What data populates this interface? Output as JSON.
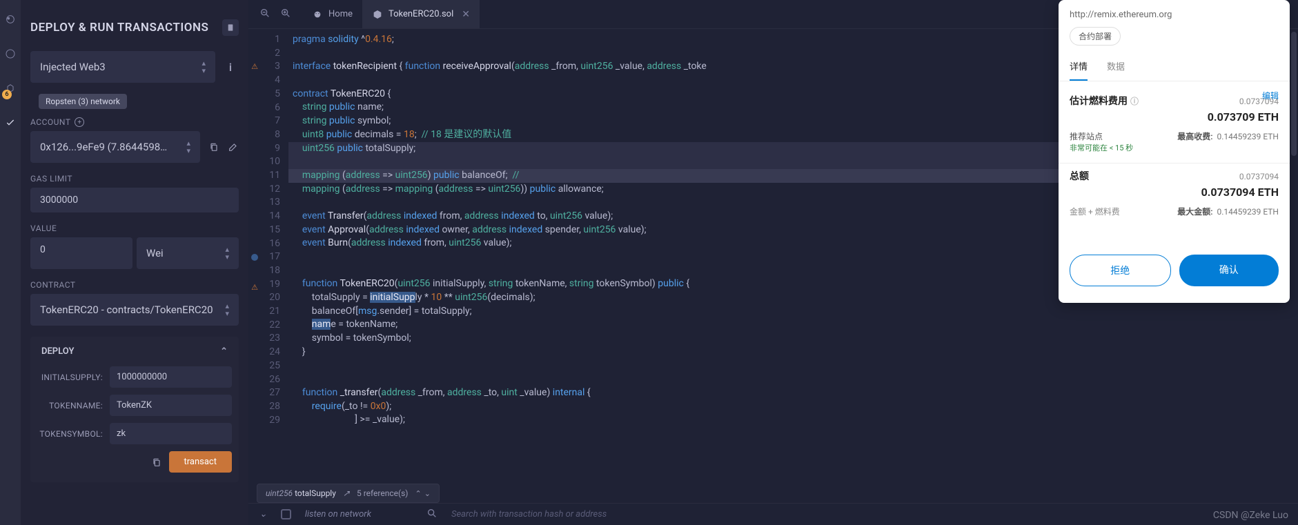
{
  "panel": {
    "title": "DEPLOY & RUN TRANSACTIONS",
    "environment": "Injected Web3",
    "network_tooltip": "Ropsten (3) network",
    "account_label": "ACCOUNT",
    "account": "0x126...9eFe9 (7.8644598…",
    "gas_label": "GAS LIMIT",
    "gas_limit": "3000000",
    "value_label": "VALUE",
    "value_amount": "0",
    "value_unit": "Wei",
    "contract_label": "CONTRACT",
    "contract": "TokenERC20 - contracts/TokenERC20",
    "deploy_label": "DEPLOY",
    "params": [
      {
        "label": "INITIALSUPPLY:",
        "value": "1000000000"
      },
      {
        "label": "TOKENNAME:",
        "value": "TokenZK"
      },
      {
        "label": "TOKENSYMBOL:",
        "value": "zk"
      }
    ],
    "transact": "transact"
  },
  "tabs": {
    "home": "Home",
    "file": "TokenERC20.sol"
  },
  "code": {
    "lines": [
      {
        "n": 1,
        "h": "<span class='kw'>pragma</span> <span class='kw2'>solidity</span> <span class='op'>^</span><span class='num'>0.4.16</span>;"
      },
      {
        "n": 2,
        "h": ""
      },
      {
        "n": 3,
        "warn": true,
        "h": "<span class='kw'>interface</span> <span class='id'>tokenRecipient</span> { <span class='kw'>function</span> <span class='id'>receiveApproval</span>(<span class='ty'>address</span> _from, <span class='ty'>uint256</span> _value, <span class='ty'>address</span> _toke"
      },
      {
        "n": 4,
        "h": ""
      },
      {
        "n": 5,
        "h": "<span class='kw'>contract</span> <span class='id'>TokenERC20</span> {"
      },
      {
        "n": 6,
        "h": "    <span class='ty'>string</span> <span class='kw2'>public</span> name;"
      },
      {
        "n": 7,
        "h": "    <span class='ty'>string</span> <span class='kw2'>public</span> symbol;"
      },
      {
        "n": 8,
        "h": "    <span class='ty'>uint8</span> <span class='kw2'>public</span> decimals = <span class='num'>18</span>;  <span class='cm'>// 18 是建议的默认值</span>"
      },
      {
        "n": 9,
        "cur": true,
        "h": "    <span class='ty'>uint256</span> <span class='kw2'>public</span> totalSupply;"
      },
      {
        "n": 10,
        "cur": true,
        "h": ""
      },
      {
        "n": 11,
        "hl": true,
        "h": "    <span class='ty'>mapping</span> (<span class='ty'>address</span> =&gt; <span class='ty'>uint256</span>) <span class='kw2'>public</span> balanceOf;  <span class='cm'>//</span>"
      },
      {
        "n": 12,
        "h": "    <span class='ty'>mapping</span> (<span class='ty'>address</span> =&gt; <span class='ty'>mapping</span> (<span class='ty'>address</span> =&gt; <span class='ty'>uint256</span>)) <span class='kw2'>public</span> allowance;"
      },
      {
        "n": 13,
        "h": ""
      },
      {
        "n": 14,
        "h": "    <span class='kw'>event</span> <span class='id'>Transfer</span>(<span class='ty'>address</span> <span class='kw2'>indexed</span> from, <span class='ty'>address</span> <span class='kw2'>indexed</span> to, <span class='ty'>uint256</span> value);"
      },
      {
        "n": 15,
        "h": "    <span class='kw'>event</span> <span class='id'>Approval</span>(<span class='ty'>address</span> <span class='kw2'>indexed</span> owner, <span class='ty'>address</span> <span class='kw2'>indexed</span> spender, <span class='ty'>uint256</span> value);"
      },
      {
        "n": 16,
        "h": "    <span class='kw'>event</span> <span class='id'>Burn</span>(<span class='ty'>address</span> <span class='kw2'>indexed</span> from, <span class='ty'>uint256</span> value);"
      },
      {
        "n": 17,
        "bp": true,
        "h": ""
      },
      {
        "n": 18,
        "h": ""
      },
      {
        "n": 19,
        "warn": true,
        "h": "    <span class='kw'>function</span> <span class='id'>TokenERC20</span>(<span class='ty'>uint256</span> initialSupply, <span class='ty'>string</span> tokenName, <span class='ty'>string</span> tokenSymbol) <span class='kw2'>public</span> {"
      },
      {
        "n": 20,
        "h": "        totalSupply = <span class='sel'>initialSupp</span>ly * <span class='num'>10</span> ** <span class='ty'>uint256</span>(decimals);"
      },
      {
        "n": 21,
        "h": "        balanceOf[<span class='kw2'>msg</span>.sender] = totalSupply;"
      },
      {
        "n": 22,
        "h": "        <span class='sel'>nam</span>e = tokenName;"
      },
      {
        "n": 23,
        "h": "        symbol = tokenSymbol;"
      },
      {
        "n": 24,
        "h": "    }"
      },
      {
        "n": 25,
        "h": ""
      },
      {
        "n": 26,
        "h": ""
      },
      {
        "n": 27,
        "h": "    <span class='kw'>function</span> <span class='id'>_transfer</span>(<span class='ty'>address</span> _from, <span class='ty'>address</span> _to, <span class='ty'>uint</span> _value) <span class='kw2'>internal</span> {"
      },
      {
        "n": 28,
        "h": "        <span class='kw2'>require</span>(_to != <span class='num'>0x0</span>);"
      },
      {
        "n": 29,
        "h": "                          ] &gt;= _value);"
      }
    ]
  },
  "ref_bar": {
    "type": "uint256",
    "name": "totalSupply",
    "count": "5 reference(s)"
  },
  "terminal": {
    "listen": "listen on network",
    "search": "Search with transaction hash or address"
  },
  "metamask": {
    "url": "http://remix.ethereum.org",
    "pill": "合约部署",
    "tab_detail": "详情",
    "tab_data": "数据",
    "edit": "编辑",
    "gas_label": "估计燃料费用",
    "gas_small": "0.0737094",
    "gas_big": "0.073709 ETH",
    "site_label": "推荐站点",
    "time_text": "非常可能在 < 15 秒",
    "max_fee_label": "最高收费:",
    "max_fee_val": "0.14459239 ETH",
    "total_label": "总额",
    "total_small": "0.0737094",
    "total_big": "0.0737094 ETH",
    "total_desc": "金额 + 燃料费",
    "max_total_label": "最大金额:",
    "max_total_val": "0.14459239 ETH",
    "reject": "拒绝",
    "confirm": "确认"
  },
  "watermark": "CSDN @Zeke Luo"
}
